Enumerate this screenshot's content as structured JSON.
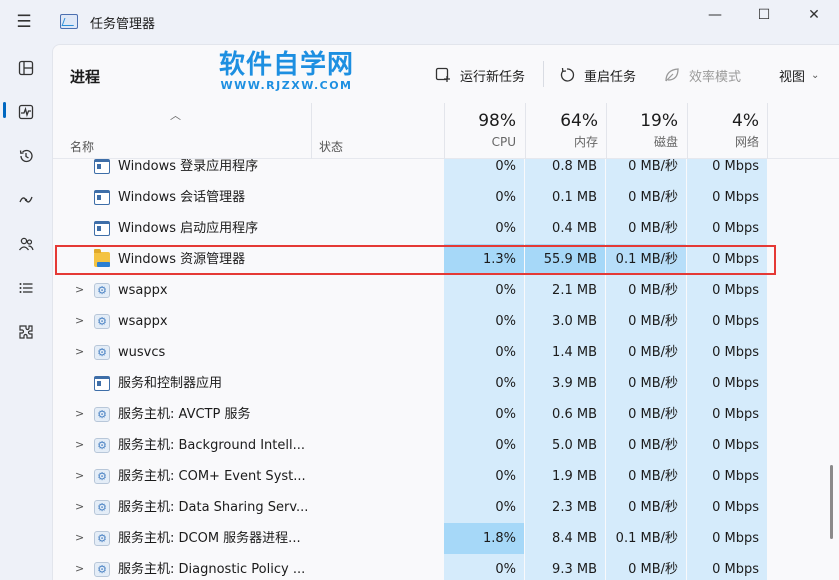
{
  "app": {
    "title": "任务管理器",
    "window_controls": {
      "minimize": "—",
      "maximize": "☐",
      "close": "✕"
    }
  },
  "watermark": {
    "cn": "软件自学网",
    "en": "WWW.RJZXW.COM"
  },
  "toolbar": {
    "page_title": "进程",
    "run_new_task": "运行新任务",
    "restart_task": "重启任务",
    "efficiency_mode": "效率模式",
    "view": "视图"
  },
  "nav": {
    "items": [
      "processes-icon",
      "performance-icon",
      "app-history-icon",
      "startup-apps-icon",
      "users-icon",
      "details-icon",
      "services-icon"
    ],
    "active": "processes-icon"
  },
  "table": {
    "columns": {
      "name": "名称",
      "status": "状态",
      "cpu": {
        "pct": "98%",
        "label": "CPU"
      },
      "memory": {
        "pct": "64%",
        "label": "内存"
      },
      "disk": {
        "pct": "19%",
        "label": "磁盘"
      },
      "network": {
        "pct": "4%",
        "label": "网络"
      }
    },
    "rows": [
      {
        "name": "Windows 登录应用程序",
        "icon": "window",
        "expander": "",
        "cpu": "0%",
        "mem": "0.8 MB",
        "disk": "0 MB/秒",
        "net": "0 Mbps"
      },
      {
        "name": "Windows 会话管理器",
        "icon": "window",
        "expander": "",
        "cpu": "0%",
        "mem": "0.1 MB",
        "disk": "0 MB/秒",
        "net": "0 Mbps"
      },
      {
        "name": "Windows 启动应用程序",
        "icon": "window",
        "expander": "",
        "cpu": "0%",
        "mem": "0.4 MB",
        "disk": "0 MB/秒",
        "net": "0 Mbps"
      },
      {
        "name": "Windows 资源管理器",
        "icon": "folder",
        "expander": "",
        "cpu": "1.3%",
        "mem": "55.9 MB",
        "disk": "0.1 MB/秒",
        "net": "0 Mbps",
        "selected": true
      },
      {
        "name": "wsappx",
        "icon": "gear",
        "expander": ">",
        "cpu": "0%",
        "mem": "2.1 MB",
        "disk": "0 MB/秒",
        "net": "0 Mbps"
      },
      {
        "name": "wsappx",
        "icon": "gear",
        "expander": ">",
        "cpu": "0%",
        "mem": "3.0 MB",
        "disk": "0 MB/秒",
        "net": "0 Mbps"
      },
      {
        "name": "wusvcs",
        "icon": "gear",
        "expander": ">",
        "cpu": "0%",
        "mem": "1.4 MB",
        "disk": "0 MB/秒",
        "net": "0 Mbps"
      },
      {
        "name": "服务和控制器应用",
        "icon": "window",
        "expander": "",
        "cpu": "0%",
        "mem": "3.9 MB",
        "disk": "0 MB/秒",
        "net": "0 Mbps"
      },
      {
        "name": "服务主机: AVCTP 服务",
        "icon": "gear",
        "expander": ">",
        "cpu": "0%",
        "mem": "0.6 MB",
        "disk": "0 MB/秒",
        "net": "0 Mbps"
      },
      {
        "name": "服务主机: Background Intell...",
        "icon": "gear",
        "expander": ">",
        "cpu": "0%",
        "mem": "5.0 MB",
        "disk": "0 MB/秒",
        "net": "0 Mbps"
      },
      {
        "name": "服务主机: COM+ Event Syst...",
        "icon": "gear",
        "expander": ">",
        "cpu": "0%",
        "mem": "1.9 MB",
        "disk": "0 MB/秒",
        "net": "0 Mbps"
      },
      {
        "name": "服务主机: Data Sharing Serv...",
        "icon": "gear",
        "expander": ">",
        "cpu": "0%",
        "mem": "2.3 MB",
        "disk": "0 MB/秒",
        "net": "0 Mbps"
      },
      {
        "name": "服务主机: DCOM 服务器进程...",
        "icon": "gear",
        "expander": ">",
        "cpu": "1.8%",
        "mem": "8.4 MB",
        "disk": "0.1 MB/秒",
        "net": "0 Mbps"
      },
      {
        "name": "服务主机: Diagnostic Policy ...",
        "icon": "gear",
        "expander": ">",
        "cpu": "0%",
        "mem": "9.3 MB",
        "disk": "0 MB/秒",
        "net": "0 Mbps"
      }
    ]
  },
  "colors": {
    "accent": "#0067c0",
    "heat_light": "#d5ebfb",
    "heat_hot": "#a6d8f8",
    "highlight_border": "#e53935",
    "watermark": "#1d8fe1"
  }
}
